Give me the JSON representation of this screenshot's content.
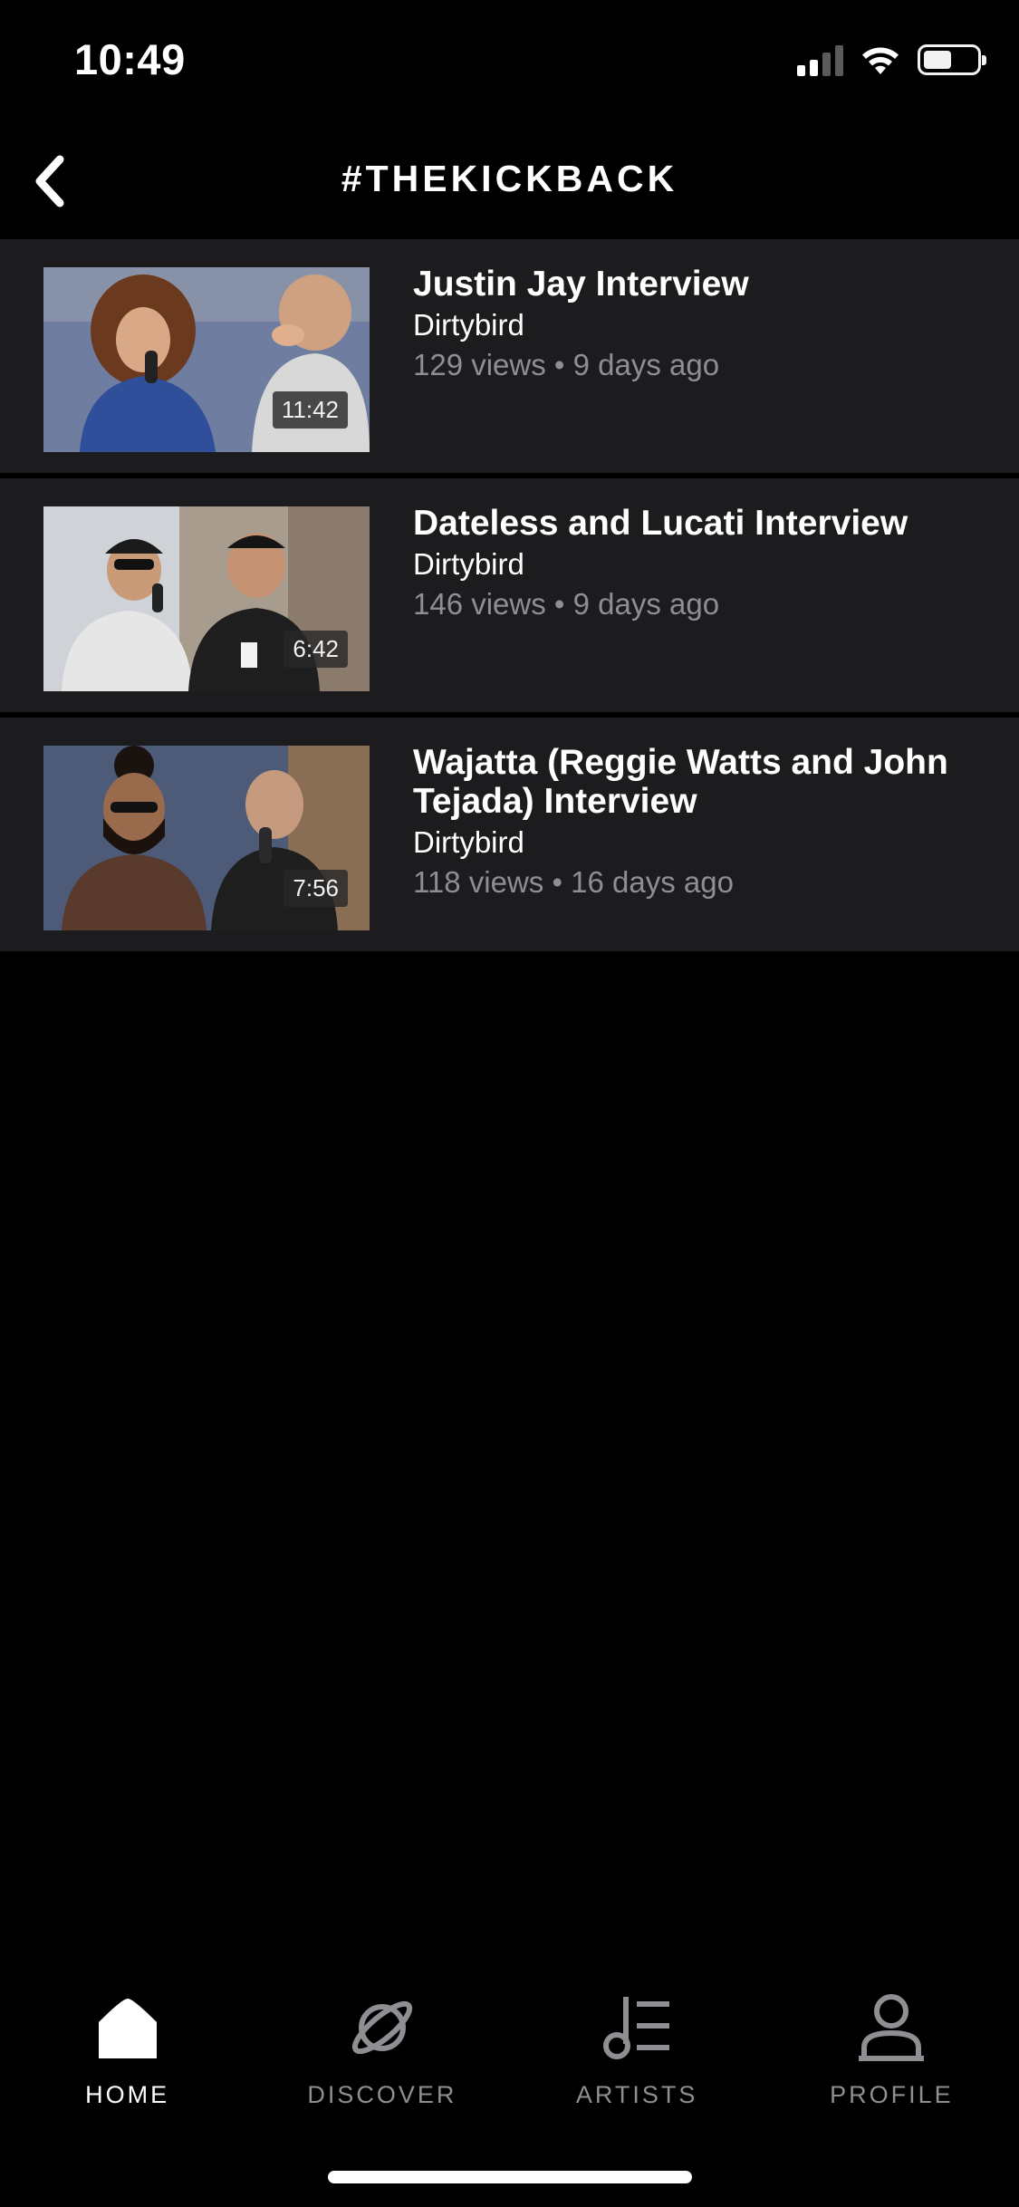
{
  "status_bar": {
    "time": "10:49",
    "icons": [
      "cellular-signal-icon",
      "wifi-icon",
      "battery-icon"
    ]
  },
  "header": {
    "title": "#THEKICKBACK",
    "back_icon": "chevron-left-icon"
  },
  "videos": [
    {
      "title": "Justin Jay Interview",
      "channel": "Dirtybird",
      "stats": "129 views • 9 days ago",
      "duration": "11:42"
    },
    {
      "title": "Dateless and Lucati Interview",
      "channel": "Dirtybird",
      "stats": "146 views • 9 days ago",
      "duration": "6:42"
    },
    {
      "title": "Wajatta (Reggie Watts and John Tejada) Interview",
      "channel": "Dirtybird",
      "stats": "118 views • 16 days ago",
      "duration": "7:56"
    }
  ],
  "tabs": [
    {
      "label": "HOME",
      "icon": "home-icon",
      "active": true
    },
    {
      "label": "DISCOVER",
      "icon": "planet-icon",
      "active": false
    },
    {
      "label": "ARTISTS",
      "icon": "music-note-list-icon",
      "active": false
    },
    {
      "label": "PROFILE",
      "icon": "person-icon",
      "active": false
    }
  ],
  "colors": {
    "background": "#000000",
    "row_background": "#1c1c1e",
    "secondary_text": "#8e8e93",
    "primary_text": "#ffffff"
  }
}
